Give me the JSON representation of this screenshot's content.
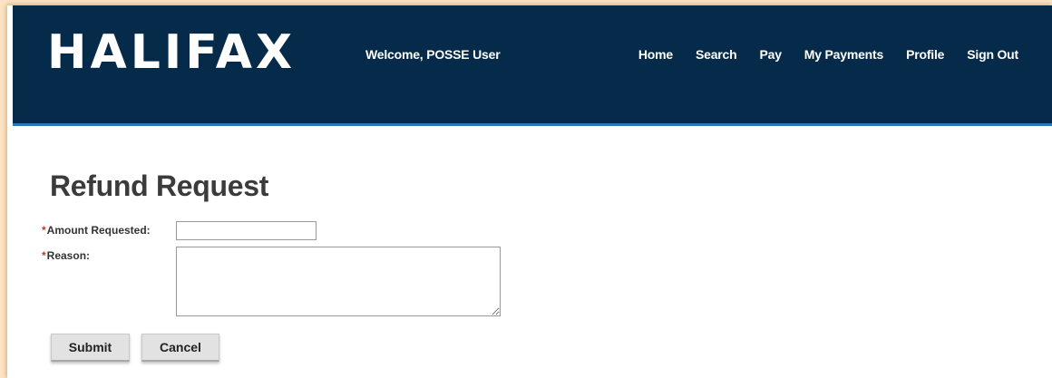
{
  "header": {
    "logo_text": "HALIFAX",
    "welcome_text": "Welcome, POSSE User",
    "nav": [
      "Home",
      "Search",
      "Pay",
      "My Payments",
      "Profile",
      "Sign Out"
    ]
  },
  "page": {
    "title": "Refund Request"
  },
  "form": {
    "required_marker": "*",
    "amount_label": "Amount Requested:",
    "amount_value": "",
    "reason_label": "Reason:",
    "reason_value": ""
  },
  "buttons": {
    "submit": "Submit",
    "cancel": "Cancel"
  },
  "colors": {
    "header_bg": "#062b4a",
    "header_border": "#2e79b4",
    "required_marker": "#c0392b",
    "page_backdrop": "#fbe3c4"
  }
}
